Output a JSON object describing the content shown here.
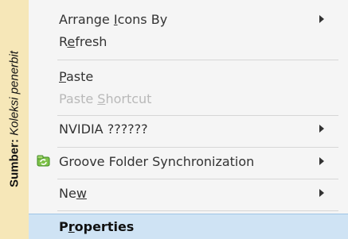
{
  "caption": {
    "label_bold": "Sumber:",
    "label_italic": "Koleksi penerbit"
  },
  "menu": {
    "items": [
      {
        "pre": "Arrange ",
        "key": "I",
        "post": "cons By",
        "submenu": true
      },
      {
        "pre": "R",
        "key": "e",
        "post": "fresh"
      },
      {
        "pre": "",
        "key": "P",
        "post": "aste"
      },
      {
        "pre": "Paste ",
        "key": "S",
        "post": "hortcut",
        "disabled": true
      },
      {
        "pre": "NVIDIA ??????",
        "key": "",
        "post": "",
        "submenu": true
      },
      {
        "pre": "Groove Folder Synchronization",
        "key": "",
        "post": "",
        "submenu": true,
        "icon": "groove-sync-icon"
      },
      {
        "pre": "Ne",
        "key": "w",
        "post": "",
        "submenu": true
      },
      {
        "pre": "P",
        "key": "r",
        "post": "operties",
        "selected": true
      }
    ]
  },
  "colors": {
    "background": "#f6e7b8",
    "menu_bg": "#f5f5f5",
    "highlight": "#cfe3f4",
    "disabled_text": "#b9b9b9"
  }
}
